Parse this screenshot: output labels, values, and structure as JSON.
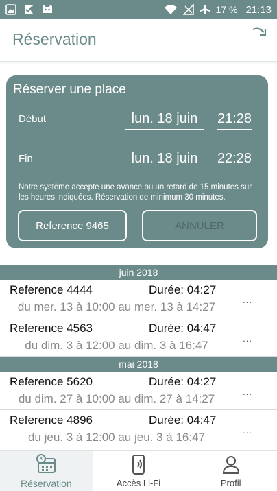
{
  "status_bar": {
    "battery": "17 %",
    "time": "21:13",
    "icons": [
      "image-icon",
      "check-flag-icon",
      "cat-icon",
      "wifi-icon",
      "no-signal-icon",
      "airplane-icon"
    ]
  },
  "header": {
    "title": "Réservation",
    "refresh_icon": "refresh-arrow-icon"
  },
  "reserve_card": {
    "title": "Réserver une place",
    "start_label": "Début",
    "start_date": "lun. 18 juin",
    "start_time": "21:28",
    "end_label": "Fin",
    "end_date": "lun. 18 juin",
    "end_time": "22:28",
    "note": "Notre système accepte une avance ou un retard de 15 minutes sur les heures indiquées. Réservation de minimum 30 minutes.",
    "reference_button": "Reference  9465",
    "cancel_button": "ANNULER"
  },
  "sections": [
    {
      "month": "juin 2018",
      "items": [
        {
          "ref": "Reference 4444",
          "duration": "Durée: 04:27",
          "range": "du mer. 13 à 10:00 au mer. 13 à 14:27",
          "menu": "..."
        },
        {
          "ref": "Reference 4563",
          "duration": "Durée: 04:47",
          "range": "du dim. 3 à 12:00 au dim. 3 à 16:47",
          "menu": "..."
        }
      ]
    },
    {
      "month": "mai 2018",
      "items": [
        {
          "ref": "Reference 5620",
          "duration": "Durée: 04:27",
          "range": "du dim. 27 à 10:00 au dim. 27 à 14:27",
          "menu": "..."
        },
        {
          "ref": "Reference 4896",
          "duration": "Durée: 04:47",
          "range": "du jeu. 3 à 12:00 au jeu. 3 à 16:47",
          "menu": "..."
        }
      ]
    }
  ],
  "bottom_nav": [
    {
      "label": "Réservation",
      "icon": "calendar-clock-icon",
      "active": true
    },
    {
      "label": "Accès Li-Fi",
      "icon": "phone-signal-icon",
      "active": false
    },
    {
      "label": "Profil",
      "icon": "person-icon",
      "active": false
    }
  ],
  "colors": {
    "primary": "#6b8b8a",
    "disabled_text": "#4f6a69"
  }
}
